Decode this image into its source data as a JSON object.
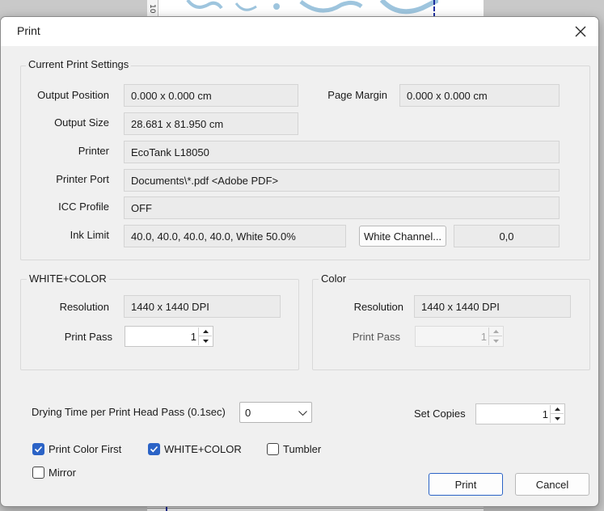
{
  "background": {
    "ruler_label": "10"
  },
  "dialog": {
    "title": "Print",
    "close_icon": "close-icon"
  },
  "current_settings": {
    "legend": "Current Print Settings",
    "output_position_label": "Output Position",
    "output_position_value": "0.000 x 0.000 cm",
    "page_margin_label": "Page Margin",
    "page_margin_value": "0.000 x 0.000 cm",
    "output_size_label": "Output Size",
    "output_size_value": "28.681 x 81.950 cm",
    "printer_label": "Printer",
    "printer_value": "EcoTank L18050",
    "printer_port_label": "Printer Port",
    "printer_port_value": "Documents\\*.pdf  <Adobe PDF>",
    "icc_profile_label": "ICC Profile",
    "icc_profile_value": "OFF",
    "ink_limit_label": "Ink Limit",
    "ink_limit_value": "40.0, 40.0, 40.0, 40.0, White 50.0%",
    "white_channel_button": "White Channel...",
    "white_channel_value": "0,0"
  },
  "white_color_group": {
    "legend": "WHITE+COLOR",
    "resolution_label": "Resolution",
    "resolution_value": "1440 x 1440 DPI",
    "print_pass_label": "Print Pass",
    "print_pass_value": "1"
  },
  "color_group": {
    "legend": "Color",
    "resolution_label": "Resolution",
    "resolution_value": "1440 x 1440 DPI",
    "print_pass_label": "Print Pass",
    "print_pass_value": "1"
  },
  "drying": {
    "label": "Drying Time per Print Head Pass (0.1sec)",
    "selected": "0"
  },
  "copies": {
    "label": "Set Copies",
    "value": "1"
  },
  "options": {
    "print_color_first": {
      "label": "Print Color First",
      "checked": true
    },
    "white_color": {
      "label": "WHITE+COLOR",
      "checked": true
    },
    "tumbler": {
      "label": "Tumbler",
      "checked": false
    },
    "mirror": {
      "label": "Mirror",
      "checked": false
    }
  },
  "buttons": {
    "print": "Print",
    "cancel": "Cancel"
  },
  "colors": {
    "checkbox_accent": "#2b63c6",
    "dialog_bg": "#f0f0f0",
    "field_bg": "#ebebeb"
  }
}
